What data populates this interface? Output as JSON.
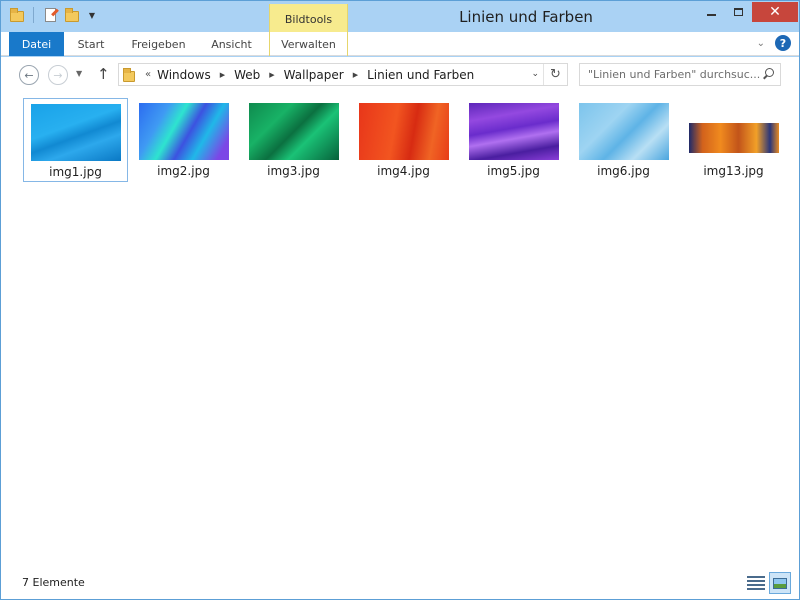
{
  "window": {
    "title": "Linien und Farben",
    "context_tab_group": "Bildtools",
    "close_glyph": "✕"
  },
  "ribbon": {
    "tabs": [
      {
        "label": "Datei"
      },
      {
        "label": "Start"
      },
      {
        "label": "Freigeben"
      },
      {
        "label": "Ansicht"
      },
      {
        "label": "Verwalten"
      }
    ],
    "help_glyph": "?",
    "expand_glyph": "⌄"
  },
  "nav": {
    "back_glyph": "←",
    "forward_glyph": "→",
    "recent_glyph": "▼",
    "up_glyph": "↑",
    "overflow_glyph": "«",
    "breadcrumbs": [
      "Windows",
      "Web",
      "Wallpaper",
      "Linien und Farben"
    ],
    "crumb_separator": "▶",
    "dropdown_glyph": "⌄",
    "refresh_glyph": "↻"
  },
  "search": {
    "placeholder": "\"Linien und Farben\" durchsuc..."
  },
  "files": [
    {
      "name": "img1.jpg",
      "selected": true
    },
    {
      "name": "img2.jpg"
    },
    {
      "name": "img3.jpg"
    },
    {
      "name": "img4.jpg"
    },
    {
      "name": "img5.jpg"
    },
    {
      "name": "img6.jpg"
    },
    {
      "name": "img13.jpg"
    }
  ],
  "status": {
    "item_count": "7 Elemente"
  },
  "colors": {
    "accent": "#1979ca",
    "context_tab": "#f7eb8e",
    "close_button": "#c7463c",
    "selection_border": "#85b7e6"
  }
}
